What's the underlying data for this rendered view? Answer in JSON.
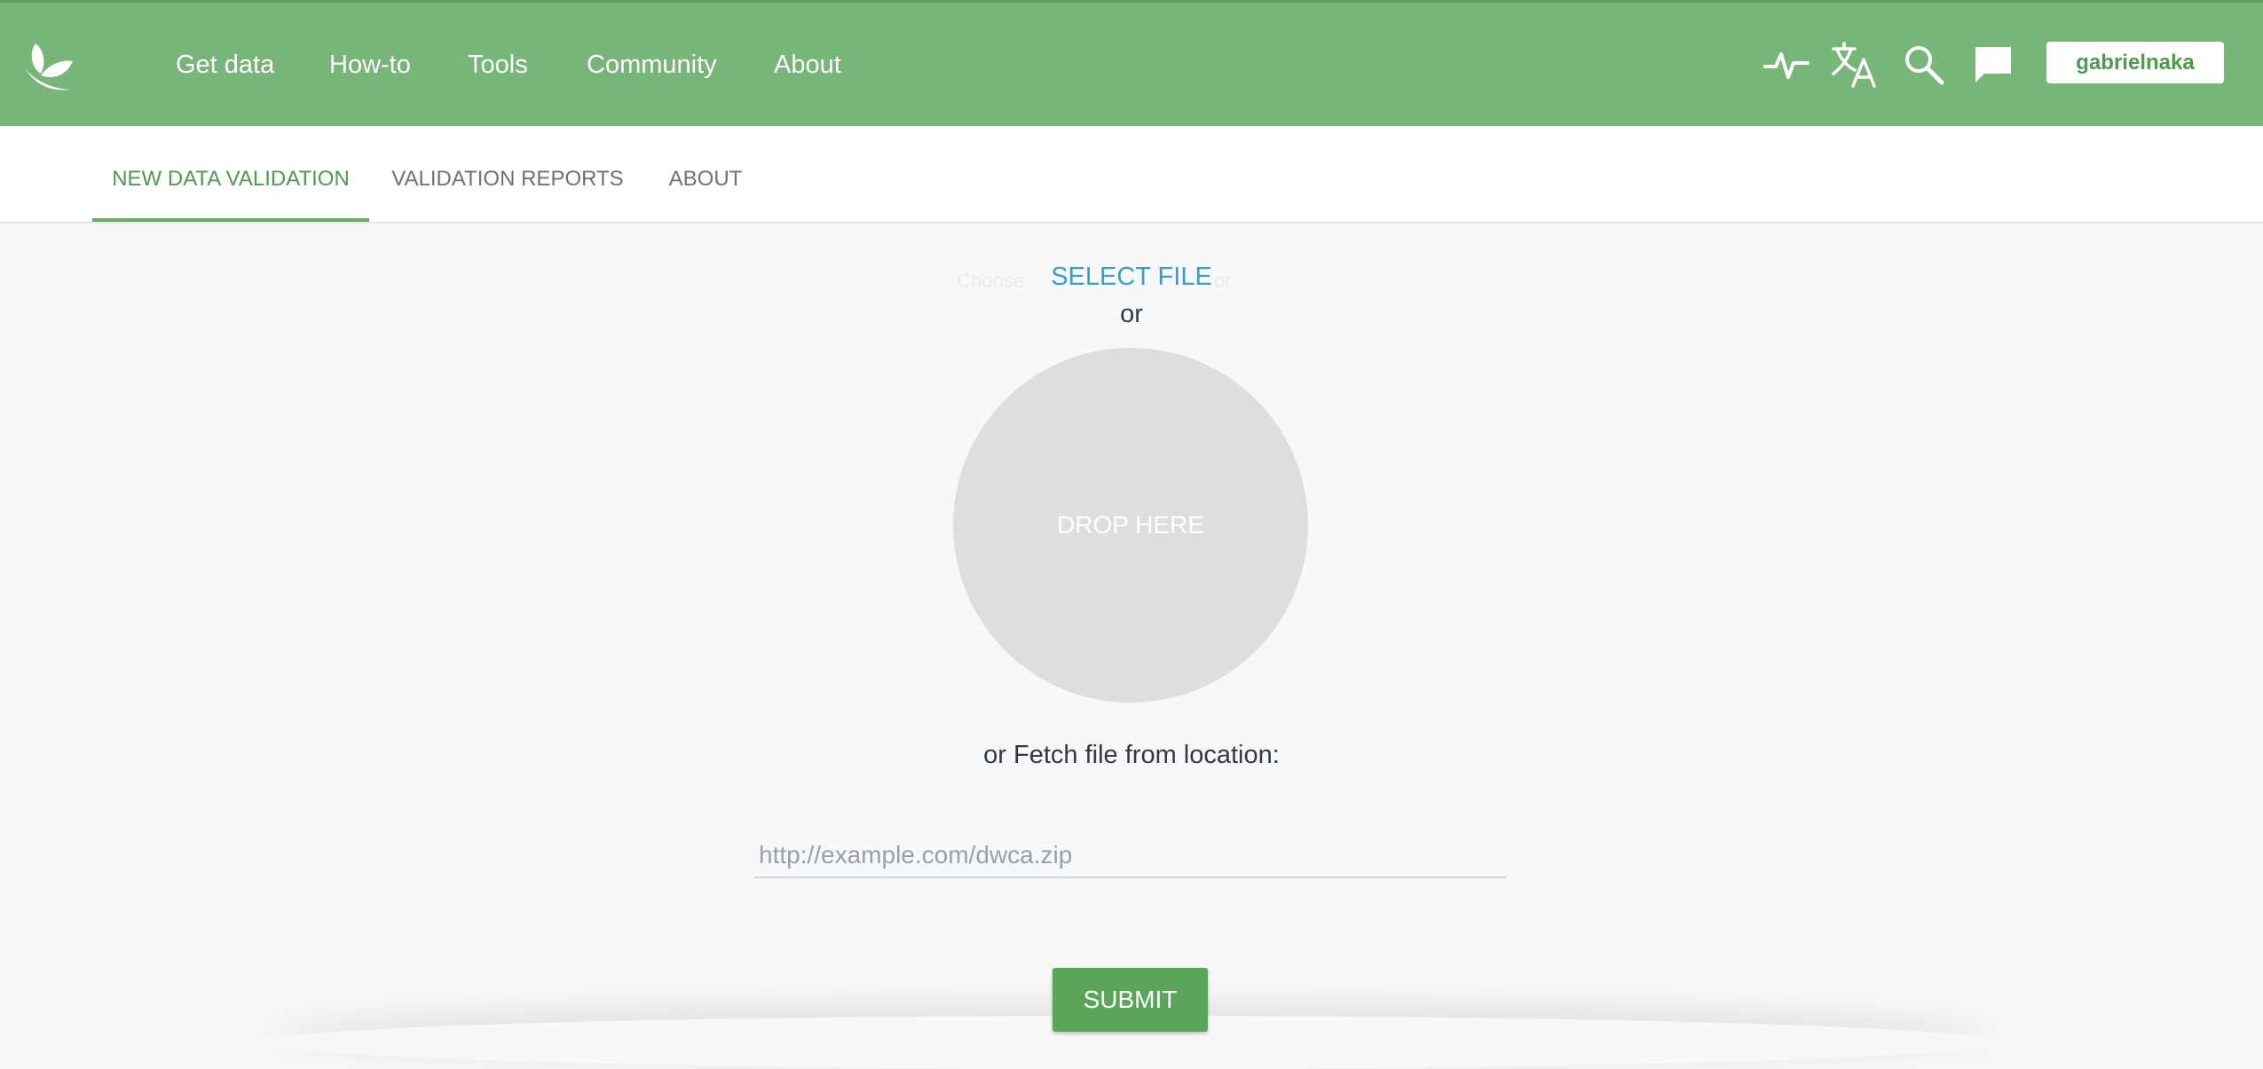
{
  "header": {
    "nav": [
      {
        "label": "Get data"
      },
      {
        "label": "How-to"
      },
      {
        "label": "Tools"
      },
      {
        "label": "Community"
      },
      {
        "label": "About"
      }
    ],
    "icons": [
      "activity-icon",
      "translate-icon",
      "search-icon",
      "feedback-icon"
    ],
    "user_label": "gabrielnaka"
  },
  "tabs": [
    {
      "label": "NEW DATA VALIDATION",
      "active": true
    },
    {
      "label": "VALIDATION REPORTS",
      "active": false
    },
    {
      "label": "ABOUT",
      "active": false
    }
  ],
  "upload": {
    "select_file_label": "SELECT FILE",
    "faint_left": "Choose",
    "faint_right": "or",
    "or_label": "or",
    "drop_label": "DROP HERE",
    "fetch_label": "or Fetch file from location:",
    "url_placeholder": "http://example.com/dwca.zip",
    "url_value": "",
    "submit_label": "SUBMIT"
  },
  "colors": {
    "header_bg": "#78b578",
    "accent_green": "#4e9a4e",
    "link_blue": "#3d9dc6",
    "submit_bg": "#5aa55a",
    "drop_zone": "#dedede"
  }
}
